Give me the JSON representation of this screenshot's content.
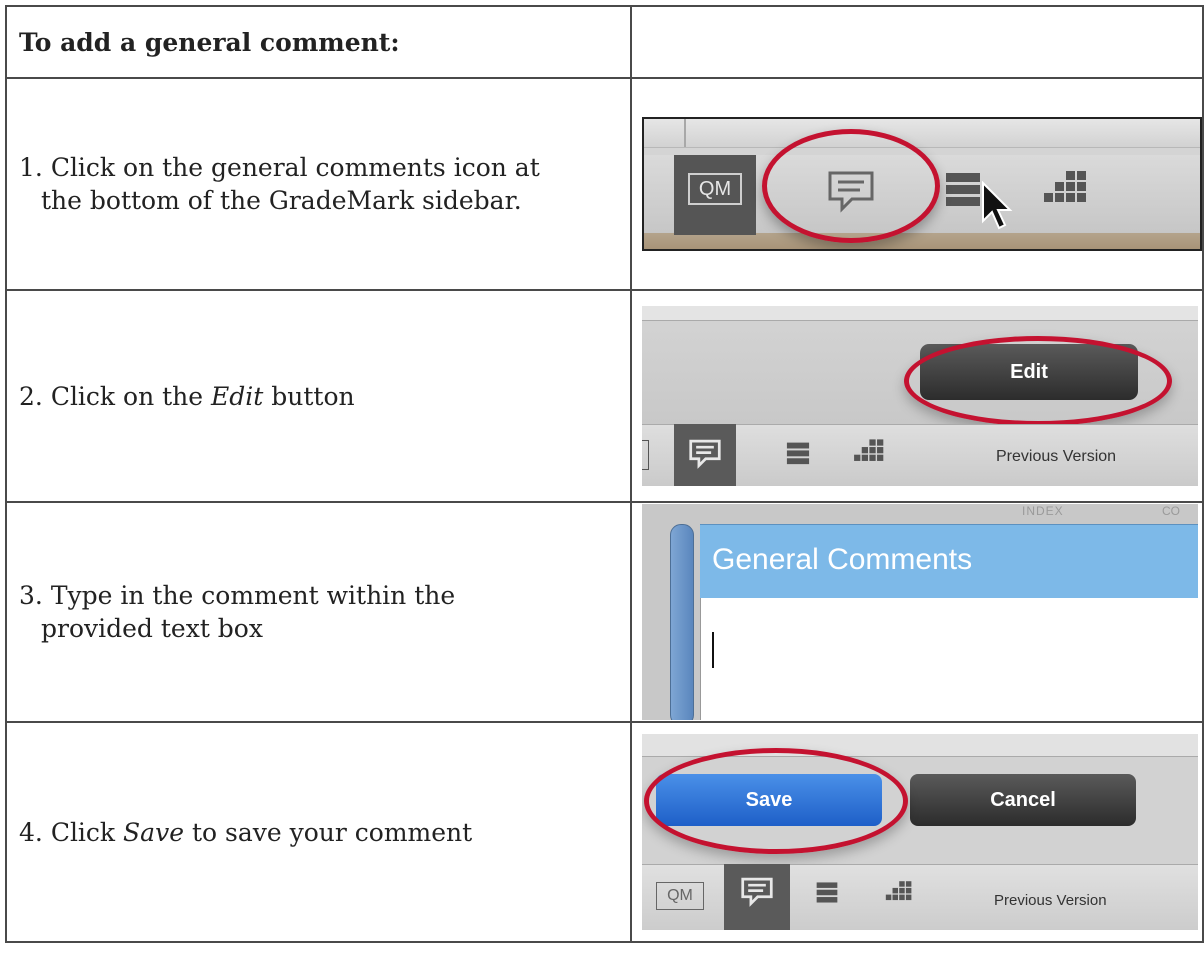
{
  "title": "To add a general comment:",
  "steps": [
    {
      "num": "1.",
      "text_a": "Click on the general comments icon at",
      "text_b": "the bottom of the GradeMark sidebar."
    },
    {
      "num": "2.",
      "pre": "Click on the",
      "em": "Edit",
      "post": "button"
    },
    {
      "num": "3.",
      "text_a": " Type in the comment within the",
      "text_b": "provided text box"
    },
    {
      "num": "4.",
      "pre": "Click",
      "em": "Save",
      "post": "to save your comment"
    }
  ],
  "shot1": {
    "qm_label": "QM"
  },
  "shot2": {
    "edit_label": "Edit",
    "prev_label": "Previous Version"
  },
  "shot3": {
    "ghost_a": "INDEX",
    "ghost_b": "CO",
    "header_label": "General Comments"
  },
  "shot4": {
    "save_label": "Save",
    "cancel_label": "Cancel",
    "qm_label": "QM",
    "prev_label": "Previous Version"
  },
  "colors": {
    "highlight_ring": "#c41230",
    "comments_header": "#7db9e8",
    "save_button": "#2f76d8"
  },
  "icons": [
    "comment-icon",
    "list-icon",
    "grid-icon",
    "cursor-icon"
  ]
}
